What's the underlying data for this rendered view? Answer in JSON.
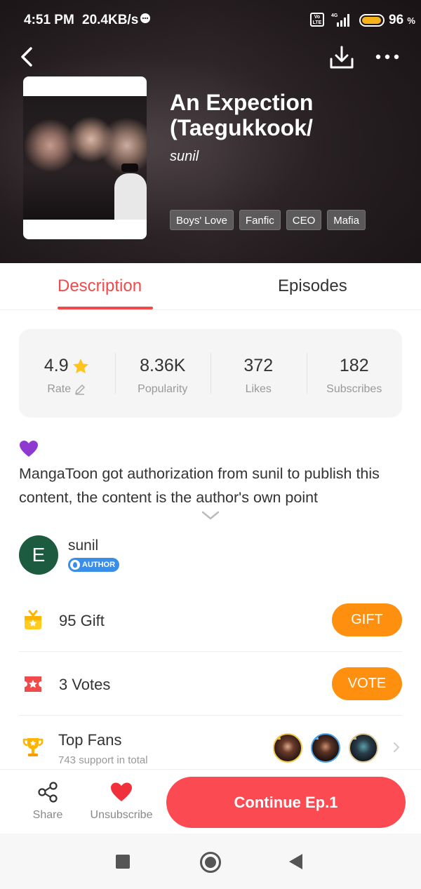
{
  "status_bar": {
    "time": "4:51 PM",
    "network_speed": "20.4KB/s",
    "volte_label": "Vo LTE",
    "network_type": "4G",
    "battery_percent": "96",
    "battery_unit": "%",
    "battery_level": 0.96
  },
  "book": {
    "title": "An Expection (Taegukkook/",
    "author": "sunil",
    "tags": [
      "Boys' Love",
      "Fanfic",
      "CEO",
      "Mafia"
    ]
  },
  "tabs": {
    "description": "Description",
    "episodes": "Episodes"
  },
  "stats": {
    "rating_value": "4.9",
    "rating_label": "Rate",
    "popularity_value": "8.36K",
    "popularity_label": "Popularity",
    "likes_value": "372",
    "likes_label": "Likes",
    "subscribes_value": "182",
    "subscribes_label": "Subscribes"
  },
  "description": {
    "text": "MangaToon got authorization from sunil to publish this content, the content is the author's own point"
  },
  "author_card": {
    "initial": "E",
    "name": "sunil",
    "badge": "AUTHOR"
  },
  "gift_row": {
    "text": "95 Gift",
    "button": "GIFT"
  },
  "vote_row": {
    "text": "3 Votes",
    "button": "VOTE"
  },
  "top_fans": {
    "title": "Top Fans",
    "subtitle": "743 support in total"
  },
  "bottom_bar": {
    "share_label": "Share",
    "unsubscribe_label": "Unsubscribe",
    "continue_label": "Continue Ep.1"
  },
  "colors": {
    "accent_red": "#f04a4a",
    "continue_button": "#fb4a52",
    "action_orange": "#ff8f0f",
    "author_badge_blue": "#3a8ee8",
    "avatar_green": "#1c5b3f",
    "star_yellow": "#ffc31f"
  }
}
